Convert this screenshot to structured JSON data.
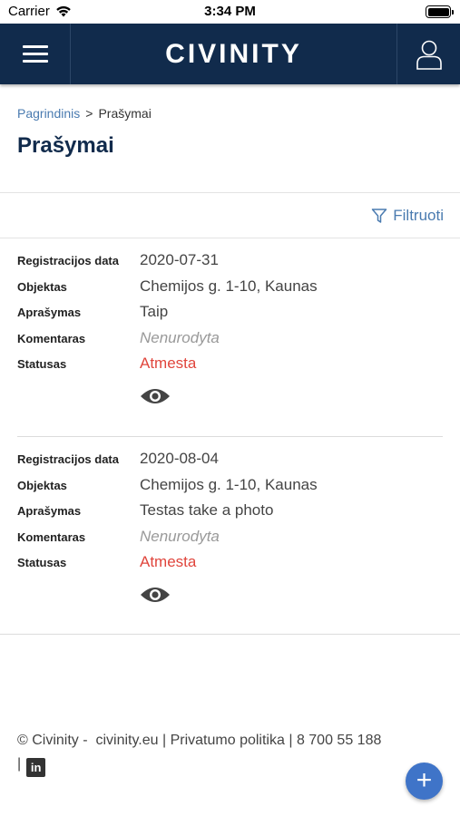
{
  "status_bar": {
    "carrier": "Carrier",
    "time": "3:34 PM",
    "icons": [
      "wifi-icon",
      "battery-icon"
    ]
  },
  "header": {
    "logo": "CIVINITY",
    "background": "#112b4c",
    "icons": [
      "menu-icon",
      "user-icon"
    ]
  },
  "breadcrumb": {
    "home": "Pagrindinis",
    "separator": ">",
    "current": "Prašymai"
  },
  "page_title": "Prašymai",
  "filter": {
    "label": "Filtruoti",
    "icon": "filter-icon"
  },
  "labels": {
    "date": "Registracijos data",
    "object": "Objektas",
    "description": "Aprašymas",
    "comment": "Komentaras",
    "status": "Statusas"
  },
  "records": [
    {
      "date": "2020-07-31",
      "object": "Chemijos g. 1-10, Kaunas",
      "description": "Taip",
      "comment": "Nenurodyta",
      "status": "Atmesta"
    },
    {
      "date": "2020-08-04",
      "object": "Chemijos g. 1-10, Kaunas",
      "description": "Testas take a photo",
      "comment": "Nenurodyta",
      "status": "Atmesta"
    }
  ],
  "colors": {
    "accent": "#4a7bb0",
    "status_rejected": "#e0453c",
    "fab": "#3f74c8"
  },
  "footer": {
    "copyright": "© Civinity -",
    "site": "civinity.eu",
    "privacy": "Privatumo politika",
    "phone": "8 700 55 188",
    "divider": "|",
    "linkedin": "in"
  },
  "fab": {
    "label": "+"
  }
}
